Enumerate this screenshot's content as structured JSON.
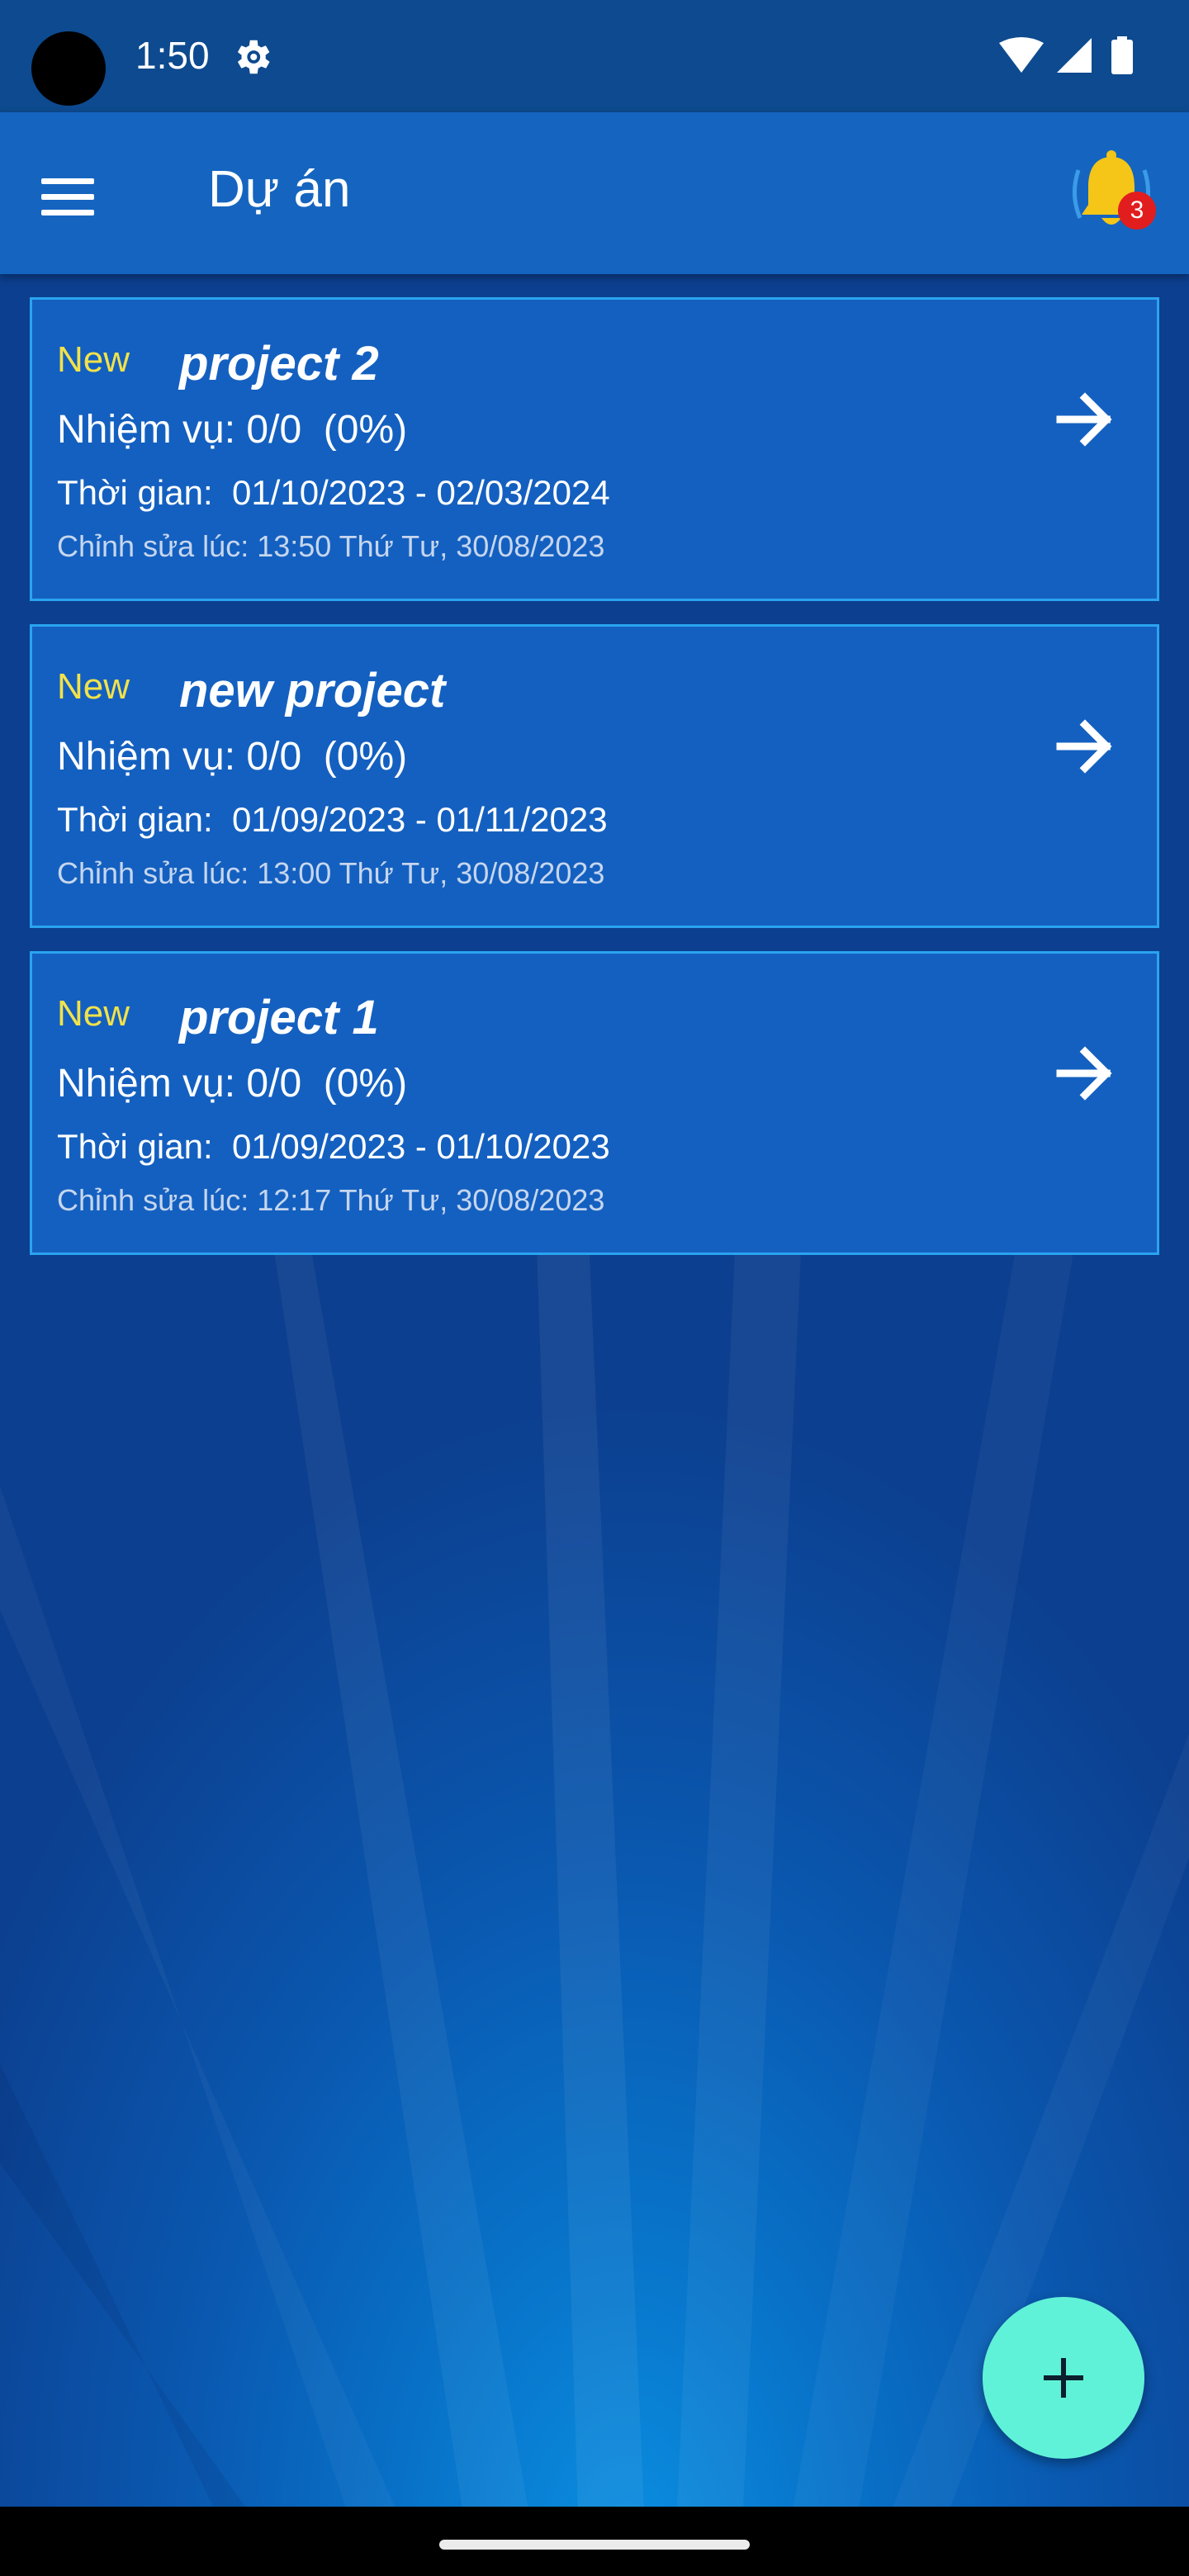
{
  "status_bar": {
    "time": "1:50",
    "icons": [
      "settings-gear-icon",
      "wifi-icon",
      "signal-icon",
      "battery-icon"
    ]
  },
  "app_bar": {
    "title": "Dự án",
    "menu_icon": "menu-icon",
    "notification_icon": "bell-icon",
    "notification_count": "3"
  },
  "projects": [
    {
      "status": "New",
      "name": "project 2",
      "tasks": "Nhiệm vụ: 0/0  (0%)",
      "period": "Thời gian:  01/10/2023 - 02/03/2024",
      "edited": "Chỉnh sửa lúc: 13:50 Thứ Tư, 30/08/2023"
    },
    {
      "status": "New",
      "name": "new project",
      "tasks": "Nhiệm vụ: 0/0  (0%)",
      "period": "Thời gian:  01/09/2023 - 01/11/2023",
      "edited": "Chỉnh sửa lúc: 13:00 Thứ Tư, 30/08/2023"
    },
    {
      "status": "New",
      "name": "project 1",
      "tasks": "Nhiệm vụ: 0/0  (0%)",
      "period": "Thời gian:  01/09/2023 - 01/10/2023",
      "edited": "Chỉnh sửa lúc: 12:17 Thứ Tư, 30/08/2023"
    }
  ],
  "fab": {
    "icon": "plus-icon"
  },
  "colors": {
    "app_bar": "#1565c0",
    "card": "#1460c0",
    "card_border": "#2aa4f0",
    "status_new": "#f2e24a",
    "fab": "#60f2d8",
    "badge": "#e21d1d"
  }
}
